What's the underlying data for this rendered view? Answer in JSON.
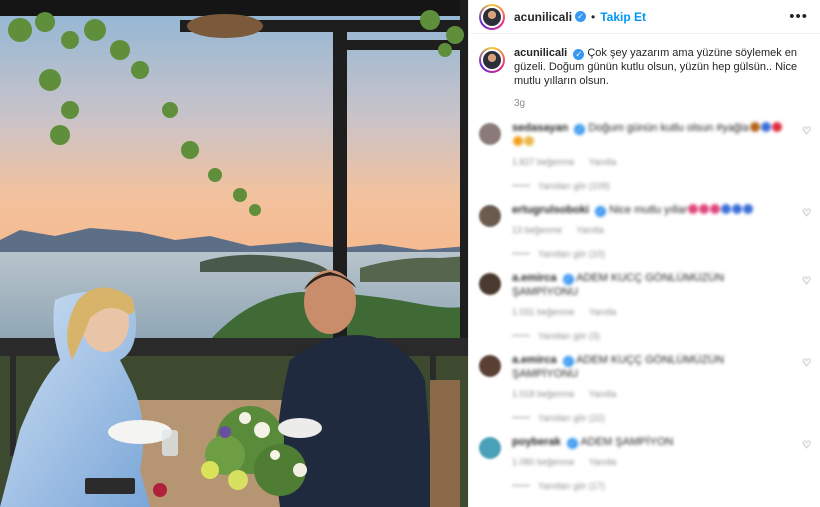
{
  "post": {
    "username": "acunilicali",
    "follow_label": "Takip Et",
    "separator": "•",
    "more_label": "•••",
    "caption_text": "Çok şey yazarım ama yüzüne söylemek en güzeli. Doğum günün kutlu olsun, yüzün hep gülsün.. Nice mutlu yılların olsun.",
    "time_ago": "3g"
  },
  "comments": [
    {
      "user": "sedasayan",
      "text": "Doğum günün kutlu olsun #yağla",
      "likes": "1.827 beğenme",
      "reply_label": "Yanıtla",
      "view_replies": "Yanıtları gör (109)",
      "avatar_color": "#8a7a7a",
      "emojis": [
        "#b5651d",
        "#3a6fd8",
        "#e02b3b",
        "#f0a020",
        "#e8b84a"
      ]
    },
    {
      "user": "ertugrulsoboki",
      "text": "Nice mutlu yıllar",
      "likes": "13 beğenme",
      "reply_label": "Yanıtla",
      "view_replies": "Yanıtları gör (10)",
      "avatar_color": "#6b5a4e",
      "emojis": [
        "#e0457b",
        "#e0457b",
        "#e0457b",
        "#3a6fd8",
        "#3a6fd8",
        "#3a6fd8"
      ]
    },
    {
      "user": "a.emirca",
      "text": "ADEM KUCÇ GÖNLÜMÜZÜN ŞAMPİYONU",
      "likes": "1.031 beğenme",
      "reply_label": "Yanıtla",
      "view_replies": "Yanıtları gör (3)",
      "avatar_color": "#4a3a30",
      "emojis": []
    },
    {
      "user": "a.emirca",
      "text": "ADEM KUÇÇ GÖNLÜMÜZÜN ŞAMPİYONU",
      "likes": "1.018 beğenme",
      "reply_label": "Yanıtla",
      "view_replies": "Yanıtları gör (22)",
      "avatar_color": "#5a3f35",
      "emojis": []
    },
    {
      "user": "poyberak",
      "text": "ADEM ŞAMPİYON",
      "likes": "1.080 beğenme",
      "reply_label": "Yanıtla",
      "view_replies": "Yanıtları gör (17)",
      "avatar_color": "#4aa0b8",
      "emojis": []
    }
  ],
  "colors": {
    "accent": "#0095f6",
    "verified": "#3897f0",
    "muted": "#8e8e8e"
  },
  "icons": {
    "verified": "verified-badge-icon",
    "more": "more-options-icon",
    "like": "heart-icon"
  }
}
